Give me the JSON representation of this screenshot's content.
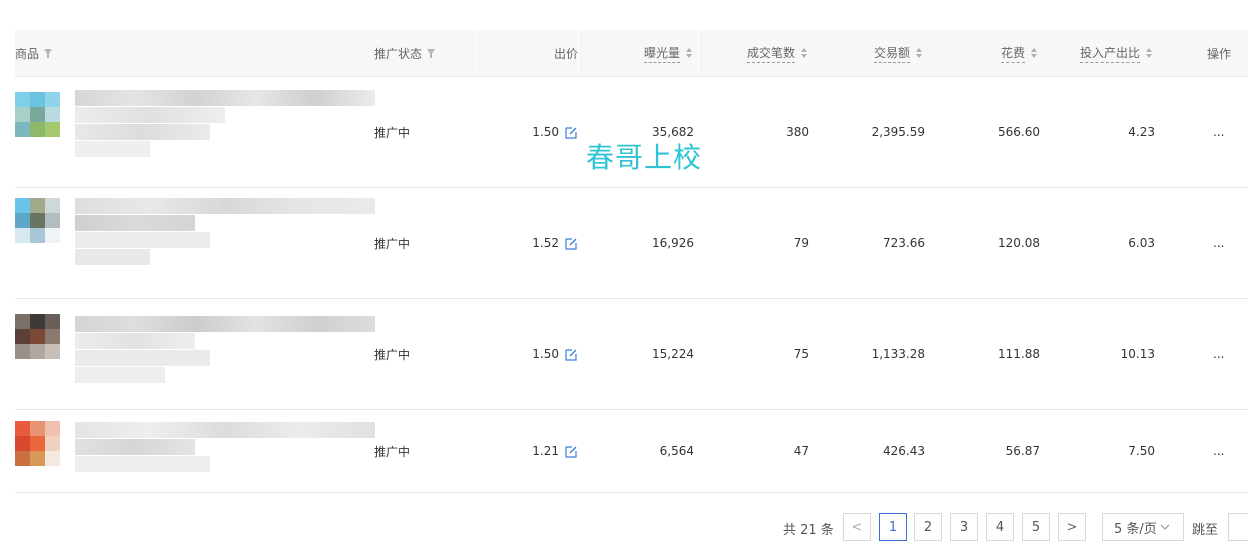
{
  "columns": {
    "product": "商品",
    "status": "推广状态",
    "bid": "出价",
    "impressions": "曝光量",
    "orders": "成交笔数",
    "gmv": "交易额",
    "cost": "花费",
    "roi": "投入产出比",
    "action": "操作"
  },
  "rows": [
    {
      "status": "推广中",
      "bid": "1.50",
      "impressions": "35,682",
      "orders": "380",
      "gmv": "2,395.59",
      "cost": "566.60",
      "roi": "4.23",
      "action": "..."
    },
    {
      "status": "推广中",
      "bid": "1.52",
      "impressions": "16,926",
      "orders": "79",
      "gmv": "723.66",
      "cost": "120.08",
      "roi": "6.03",
      "action": "..."
    },
    {
      "status": "推广中",
      "bid": "1.50",
      "impressions": "15,224",
      "orders": "75",
      "gmv": "1,133.28",
      "cost": "111.88",
      "roi": "10.13",
      "action": "..."
    },
    {
      "status": "推广中",
      "bid": "1.21",
      "impressions": "6,564",
      "orders": "47",
      "gmv": "426.43",
      "cost": "56.87",
      "roi": "7.50",
      "action": "..."
    }
  ],
  "watermark": "春哥上校",
  "pagination": {
    "total": "共 21 条",
    "pages": [
      "1",
      "2",
      "3",
      "4",
      "5"
    ],
    "current": "1",
    "prev": "<",
    "next": ">",
    "page_size": "5 条/页",
    "jump_label": "跳至"
  },
  "colors": {
    "accent": "#3a6fd8",
    "watermark": "#2ec4d6",
    "edit_icon": "#3a7fd8"
  },
  "thumbnails": [
    [
      "#7ecfe8",
      "#6ac3e0",
      "#8fd4ea",
      "#a9cfc8",
      "#79a99b",
      "#b9dbe0",
      "#7bb7bd",
      "#8fb86a",
      "#a4c96e"
    ],
    [
      "#6bc4ea",
      "#a3aa8c",
      "#cfd8d8",
      "#5fa7c9",
      "#6a7462",
      "#b3bcc0",
      "#d8e8f0",
      "#a7c7d8",
      "#eef4f6"
    ],
    [
      "#7a7068",
      "#3e3a38",
      "#6a5e58",
      "#5a4038",
      "#7a4a36",
      "#8a7a70",
      "#9a9088",
      "#b0a8a0",
      "#c8c0b8"
    ],
    [
      "#e85a3a",
      "#e89474",
      "#f0c0b0",
      "#d84830",
      "#e8683c",
      "#f0d0c0",
      "#c87040",
      "#d89858",
      "#f4e8e0"
    ]
  ]
}
